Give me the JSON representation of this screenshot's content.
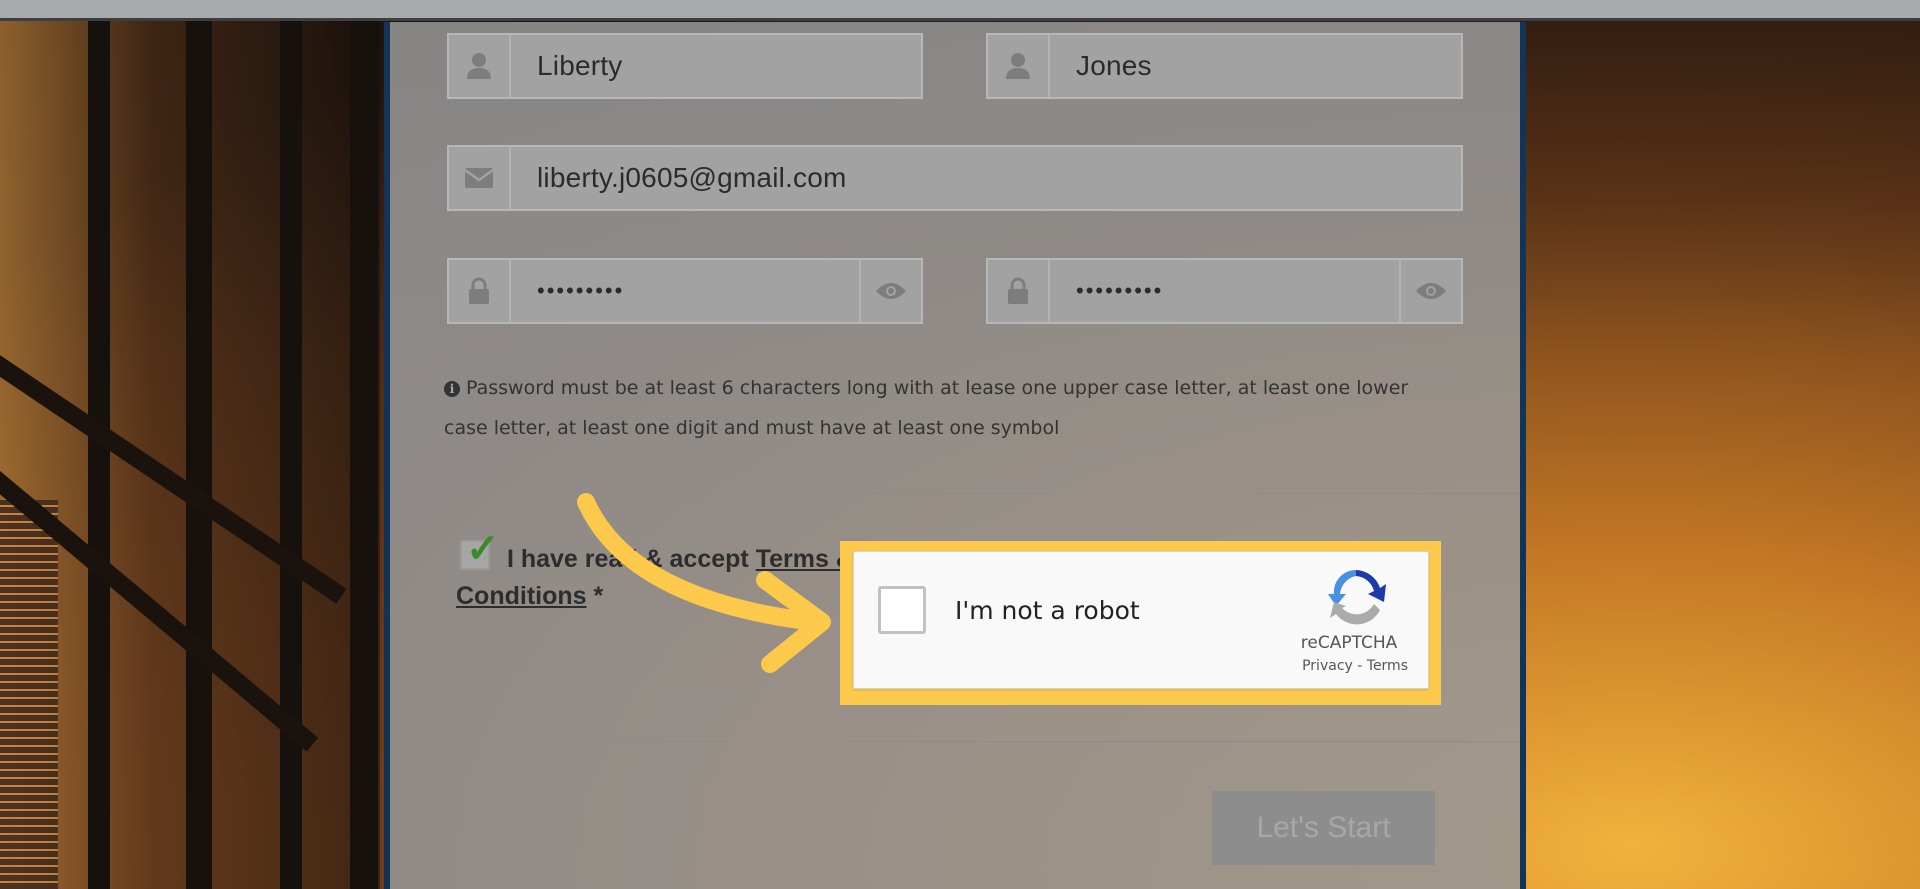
{
  "form": {
    "first_name": "Liberty",
    "last_name": "Jones",
    "email": "liberty.j0605@gmail.com",
    "password_masked": "•••••••••",
    "confirm_password_masked": "•••••••••",
    "password_hint": "Password must be at least 6 characters long with at lease one upper case letter, at least one lower case letter, at least one digit and must have at least one symbol",
    "terms_prefix": "I have read & accept",
    "terms_link_1": "Terms &",
    "terms_link_2": "Conditions",
    "terms_required": " *",
    "submit_label": "Let's Start"
  },
  "recaptcha": {
    "label": "I'm not a robot",
    "brand": "reCAPTCHA",
    "privacy": "Privacy",
    "separator": " - ",
    "terms": "Terms"
  },
  "colors": {
    "highlight": "#fdc94a",
    "panel_border": "#123456",
    "check_green": "#3a8a2a"
  },
  "icons": [
    "user-icon",
    "envelope-icon",
    "lock-icon",
    "eye-icon",
    "info-icon",
    "recaptcha-logo-icon",
    "arrow-annotation-icon"
  ]
}
